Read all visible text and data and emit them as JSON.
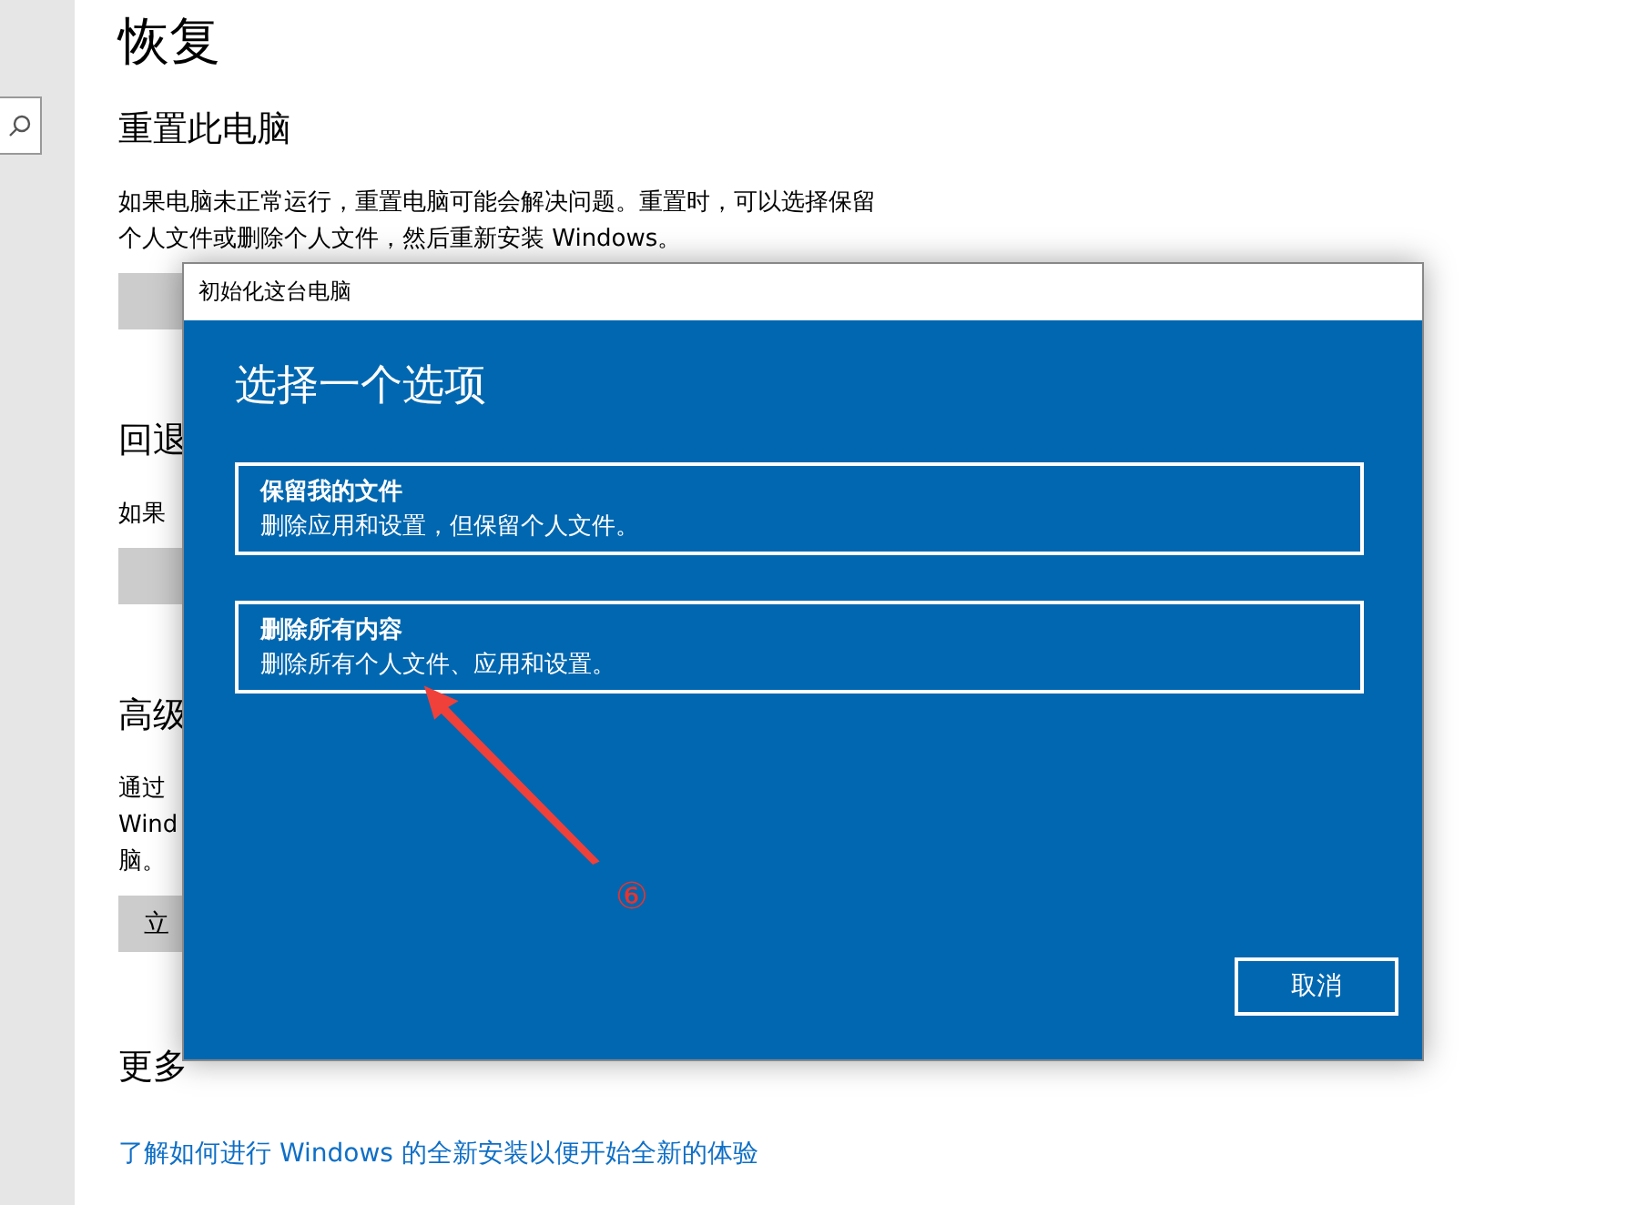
{
  "page": {
    "title": "恢复",
    "sections": [
      {
        "heading": "重置此电脑",
        "lines": [
          "如果电脑未正常运行，重置电脑可能会解决问题。重置时，可以选择保留",
          "个人文件或删除个人文件，然后重新安装 Windows。"
        ],
        "button": true
      },
      {
        "heading": "回退",
        "lines": [
          "如果"
        ],
        "button": true
      },
      {
        "heading": "高级",
        "lines": [
          "通过",
          "Wind",
          "脑。"
        ],
        "button_label": "立"
      },
      {
        "heading": "更多"
      }
    ],
    "link": "了解如何进行 Windows 的全新安装以便开始全新的体验"
  },
  "dialog": {
    "title": "初始化这台电脑",
    "heading": "选择一个选项",
    "options": [
      {
        "title": "保留我的文件",
        "description": "删除应用和设置，但保留个人文件。"
      },
      {
        "title": "删除所有内容",
        "description": "删除所有个人文件、应用和设置。"
      }
    ],
    "cancel": "取消"
  },
  "annotation": {
    "label": "⑥"
  }
}
